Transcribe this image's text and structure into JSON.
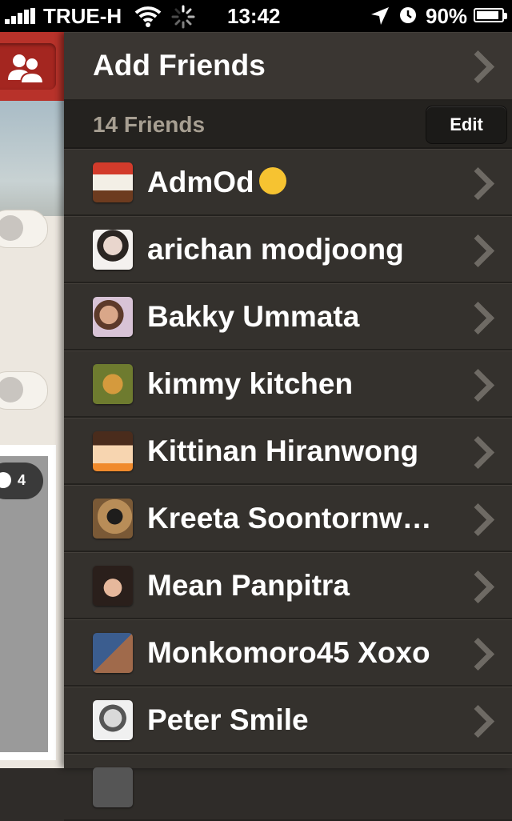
{
  "status_bar": {
    "carrier": "TRUE-H",
    "time": "13:42",
    "battery_percent": "90%",
    "battery_level": 0.9
  },
  "left_panel": {
    "comment_count": "4"
  },
  "drawer": {
    "add_friends_label": "Add Friends",
    "friends_count_label": "14 Friends",
    "edit_label": "Edit",
    "friends": [
      {
        "name": "AdmOd",
        "emoji": "face-screaming-emoji"
      },
      {
        "name": "arichan modjoong"
      },
      {
        "name": "Bakky Ummata"
      },
      {
        "name": "kimmy kitchen"
      },
      {
        "name": "Kittinan Hiranwong"
      },
      {
        "name": "Kreeta Soontornw…"
      },
      {
        "name": "Mean Panpitra"
      },
      {
        "name": "Monkomoro45 Xoxo"
      },
      {
        "name": "Peter Smile"
      }
    ]
  },
  "colors": {
    "drawer_bg": "#34312d",
    "header_bg": "#24221f",
    "brand_red": "#b8322a",
    "subheader_text": "#a79f92"
  }
}
